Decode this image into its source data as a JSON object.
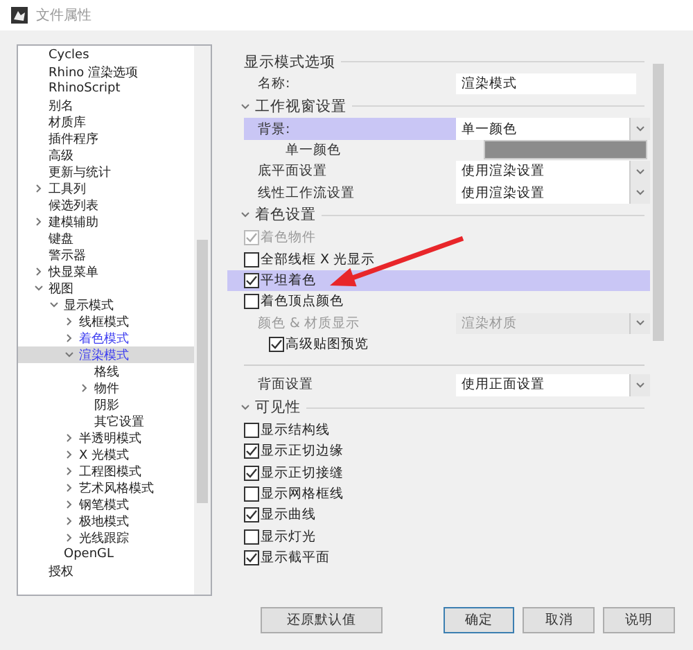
{
  "window": {
    "title": "文件属性"
  },
  "tree": [
    {
      "label": "Cycles",
      "selected": false,
      "changed": false
    },
    {
      "label": "Rhino 渲染选项",
      "selected": false,
      "changed": false
    },
    {
      "label": "RhinoScript",
      "selected": false,
      "changed": false
    },
    {
      "label": "别名",
      "selected": false,
      "changed": false
    },
    {
      "label": "材质库",
      "selected": false,
      "changed": false
    },
    {
      "label": "插件程序",
      "selected": false,
      "changed": false
    },
    {
      "label": "高级",
      "selected": false,
      "changed": false
    },
    {
      "label": "更新与统计",
      "selected": false,
      "changed": false
    },
    {
      "label": "工具列",
      "selected": false,
      "changed": false,
      "expanded": false
    },
    {
      "label": "候选列表",
      "selected": false,
      "changed": false
    },
    {
      "label": "建模辅助",
      "selected": false,
      "changed": false,
      "expanded": false
    },
    {
      "label": "键盘",
      "selected": false,
      "changed": false
    },
    {
      "label": "警示器",
      "selected": false,
      "changed": false
    },
    {
      "label": "快显菜单",
      "selected": false,
      "changed": false,
      "expanded": false
    },
    {
      "label": "视图",
      "selected": false,
      "changed": false,
      "expanded": true,
      "children": [
        {
          "label": "显示模式",
          "selected": false,
          "changed": false,
          "expanded": true,
          "children": [
            {
              "label": "线框模式",
              "selected": false,
              "changed": false,
              "expanded": false
            },
            {
              "label": "着色模式",
              "selected": false,
              "changed": true,
              "expanded": false
            },
            {
              "label": "渲染模式",
              "selected": true,
              "changed": true,
              "expanded": true,
              "children": [
                {
                  "label": "格线",
                  "selected": false,
                  "changed": false
                },
                {
                  "label": "物件",
                  "selected": false,
                  "changed": false,
                  "expanded": false
                },
                {
                  "label": "阴影",
                  "selected": false,
                  "changed": false
                },
                {
                  "label": "其它设置",
                  "selected": false,
                  "changed": false
                }
              ]
            },
            {
              "label": "半透明模式",
              "selected": false,
              "changed": false,
              "expanded": false
            },
            {
              "label": "X 光模式",
              "selected": false,
              "changed": false,
              "expanded": false
            },
            {
              "label": "工程图模式",
              "selected": false,
              "changed": false,
              "expanded": false
            },
            {
              "label": "艺术风格模式",
              "selected": false,
              "changed": false,
              "expanded": false
            },
            {
              "label": "钢笔模式",
              "selected": false,
              "changed": false,
              "expanded": false
            },
            {
              "label": "极地模式",
              "selected": false,
              "changed": false,
              "expanded": false
            },
            {
              "label": "光线跟踪",
              "selected": false,
              "changed": false,
              "expanded": false
            }
          ]
        },
        {
          "label": "OpenGL",
          "selected": false,
          "changed": false
        }
      ]
    },
    {
      "label": "授权",
      "selected": false,
      "changed": false
    }
  ],
  "rows": [
    {
      "kind": "section",
      "label": "显示模式选项"
    },
    {
      "kind": "text",
      "label": "名称:",
      "value": "渲染模式",
      "selected": false
    },
    {
      "kind": "section",
      "label": "工作视窗设置",
      "expanded": true
    },
    {
      "kind": "dropdown",
      "label": "背景:",
      "value": "单一颜色",
      "selected": true,
      "disabled": false
    },
    {
      "kind": "color",
      "label": "单一颜色",
      "color": "#8c8c8c",
      "selected": false
    },
    {
      "kind": "dropdown",
      "label": "底平面设置",
      "value": "使用渲染设置",
      "selected": false,
      "disabled": false
    },
    {
      "kind": "dropdown",
      "label": "线性工作流设置",
      "value": "使用渲染设置",
      "selected": false,
      "disabled": false
    },
    {
      "kind": "section",
      "label": "着色设置",
      "expanded": true
    },
    {
      "kind": "checkbox",
      "label": "着色物件",
      "checked": true,
      "disabled": true,
      "selected": false
    },
    {
      "kind": "checkbox",
      "label": "全部线框 X 光显示",
      "checked": false,
      "disabled": false,
      "selected": false
    },
    {
      "kind": "checkbox",
      "label": "平坦着色",
      "checked": true,
      "disabled": false,
      "selected": true
    },
    {
      "kind": "checkbox",
      "label": "着色顶点颜色",
      "checked": false,
      "disabled": false,
      "selected": false
    },
    {
      "kind": "dropdown",
      "label": "颜色 & 材质显示",
      "value": "渲染材质",
      "selected": false,
      "disabled": true
    },
    {
      "kind": "subcheckbox",
      "label": "高级贴图预览",
      "checked": true,
      "disabled": false,
      "selected": false
    },
    {
      "kind": "divider"
    },
    {
      "kind": "dropdown",
      "label": "背面设置",
      "value": "使用正面设置",
      "selected": false,
      "disabled": false
    },
    {
      "kind": "section",
      "label": "可见性",
      "expanded": true
    },
    {
      "kind": "checkbox",
      "label": "显示结构线",
      "checked": false,
      "disabled": false,
      "selected": false
    },
    {
      "kind": "checkbox",
      "label": "显示正切边缘",
      "checked": true,
      "disabled": false,
      "selected": false
    },
    {
      "kind": "checkbox",
      "label": "显示正切接缝",
      "checked": true,
      "disabled": false,
      "selected": false
    },
    {
      "kind": "checkbox",
      "label": "显示网格框线",
      "checked": false,
      "disabled": false,
      "selected": false
    },
    {
      "kind": "checkbox",
      "label": "显示曲线",
      "checked": true,
      "disabled": false,
      "selected": false
    },
    {
      "kind": "checkbox",
      "label": "显示灯光",
      "checked": false,
      "disabled": false,
      "selected": false
    },
    {
      "kind": "checkbox",
      "label": "显示截平面",
      "checked": true,
      "disabled": false,
      "selected": false
    }
  ],
  "buttons": [
    {
      "label": "还原默认值",
      "default": false
    },
    {
      "label": "确定",
      "default": true
    },
    {
      "label": "取消",
      "default": false
    },
    {
      "label": "说明",
      "default": false
    }
  ]
}
